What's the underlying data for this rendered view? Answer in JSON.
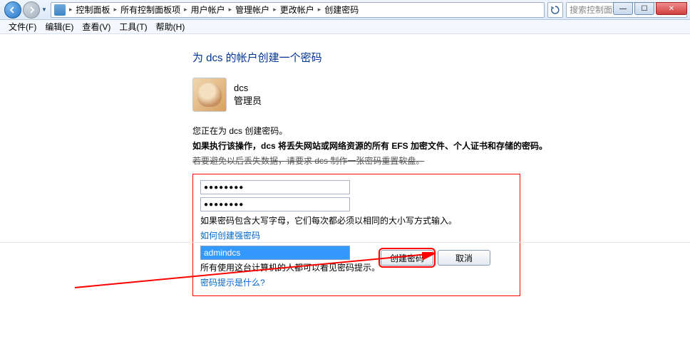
{
  "breadcrumb": {
    "items": [
      "控制面板",
      "所有控制面板项",
      "用户帐户",
      "管理帐户",
      "更改帐户",
      "创建密码"
    ]
  },
  "search": {
    "placeholder": "搜索控制面板"
  },
  "menubar": {
    "file": "文件(F)",
    "edit": "编辑(E)",
    "view": "查看(V)",
    "tools": "工具(T)",
    "help": "帮助(H)"
  },
  "page": {
    "title": "为 dcs 的帐户创建一个密码",
    "user_name": "dcs",
    "user_role": "管理员",
    "line1": "您正在为 dcs 创建密码。",
    "line2": "如果执行该操作，dcs 将丢失网站或网络资源的所有 EFS 加密文件、个人证书和存储的密码。",
    "line3": "若要避免以后丢失数据，请要求 dcs 制作一张密码重置软盘。",
    "pw1": "●●●●●●●●",
    "pw2": "●●●●●●●●",
    "case_note": "如果密码包含大写字母，它们每次都必须以相同的大小写方式输入。",
    "strong_link": "如何创建强密码",
    "hint_value": "admindcs",
    "hint_note": "所有使用这台计算机的人都可以看见密码提示。",
    "hint_link": "密码提示是什么?",
    "btn_create": "创建密码",
    "btn_cancel": "取消"
  }
}
